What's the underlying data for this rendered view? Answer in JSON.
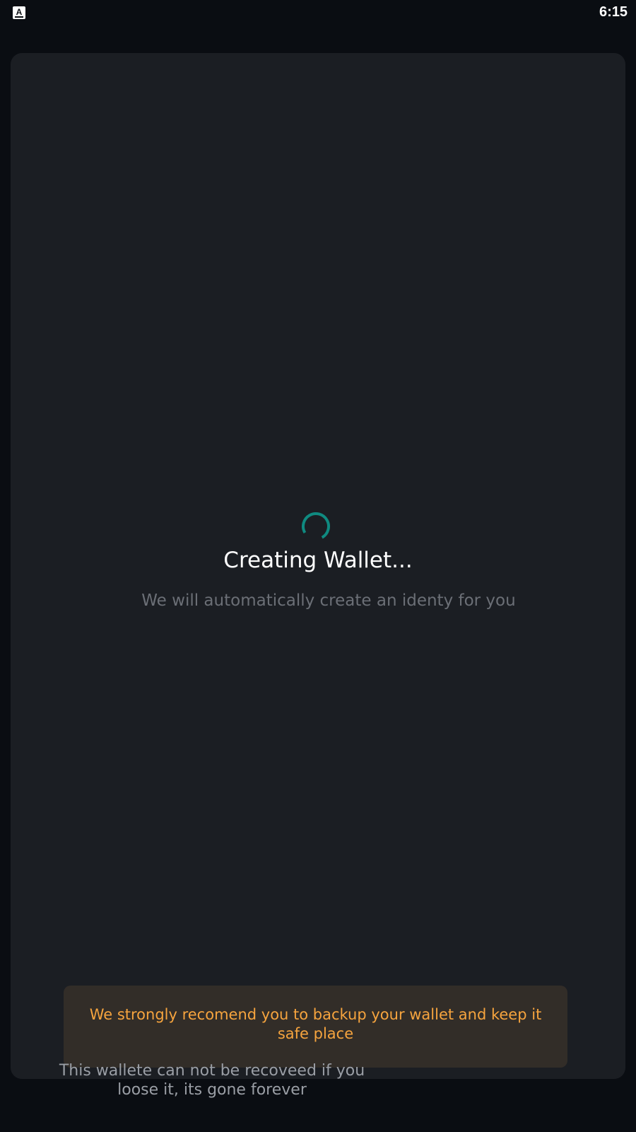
{
  "status_bar": {
    "app_icon": "app-store-icon",
    "time": "6:15"
  },
  "loading": {
    "spinner_icon": "loading-spinner-icon",
    "spinner_color": "#0f8a80",
    "title": "Creating Wallet...",
    "subtitle": "We will automatically create an identy for you"
  },
  "warning": {
    "text": "We strongly recomend you to backup your wallet and keep it safe place",
    "text_color": "#f6a43e"
  },
  "footer": {
    "note": "This wallete can not be recoveed if you loose it, its gone forever"
  }
}
